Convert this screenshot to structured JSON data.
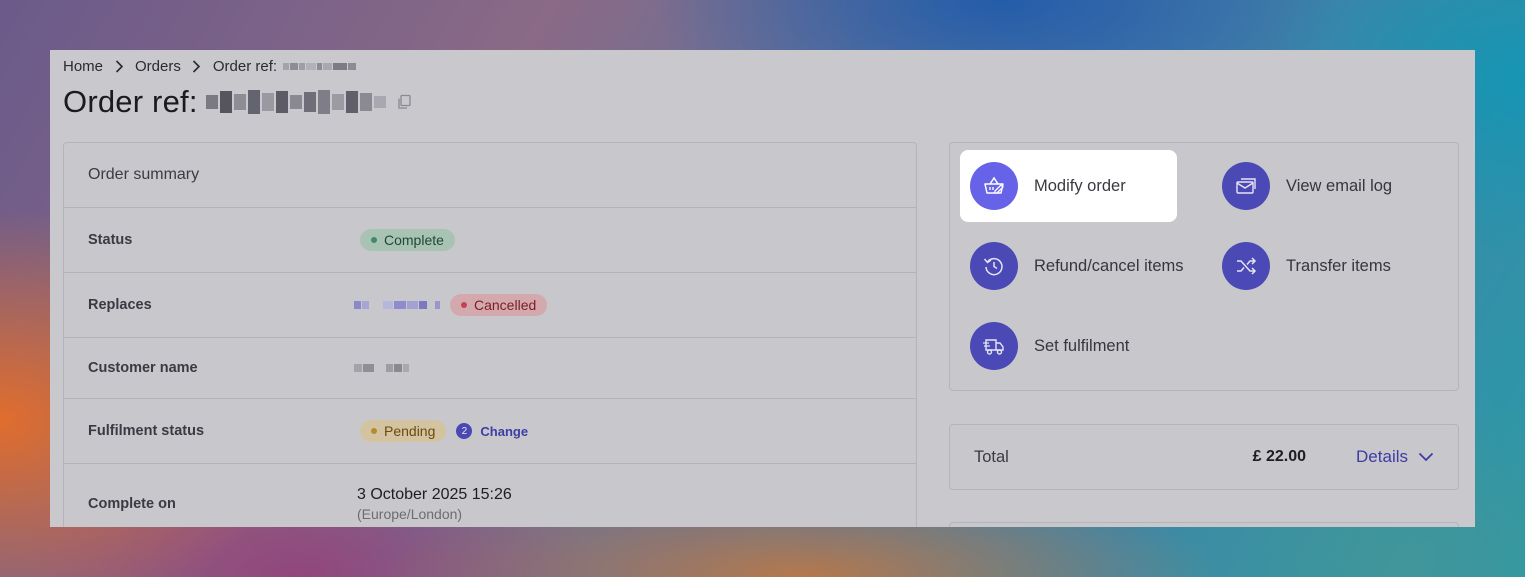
{
  "breadcrumb": {
    "items": [
      "Home",
      "Orders"
    ],
    "current_label": "Order ref:"
  },
  "page": {
    "title": "Order ref:"
  },
  "summary": {
    "heading": "Order summary",
    "status_label": "Status",
    "status_value": "Complete",
    "replaces_label": "Replaces",
    "replaces_status": "Cancelled",
    "customer_label": "Customer name",
    "fulfilment_label": "Fulfilment status",
    "fulfilment_value": "Pending",
    "fulfilment_count": "2",
    "change_label": "Change",
    "complete_label": "Complete on",
    "complete_date": "3 October 2025 15:26",
    "complete_tz": "(Europe/London)"
  },
  "actions": {
    "modify": "Modify order",
    "email_log": "View email log",
    "refund": "Refund/cancel items",
    "transfer": "Transfer items",
    "fulfilment": "Set fulfilment"
  },
  "total": {
    "label": "Total",
    "amount": "£ 22.00",
    "details": "Details"
  },
  "colors": {
    "accent": "#4b49b5",
    "highlight_accent": "#6663e8",
    "complete_badge": "#a8c3b4",
    "cancelled_badge": "#d4a9ad",
    "pending_badge": "#d3c3a0"
  },
  "icons": [
    "chevron-right-icon",
    "copy-icon",
    "basket-edit-icon",
    "email-log-icon",
    "history-icon",
    "shuffle-icon",
    "truck-icon",
    "chevron-down-icon"
  ]
}
